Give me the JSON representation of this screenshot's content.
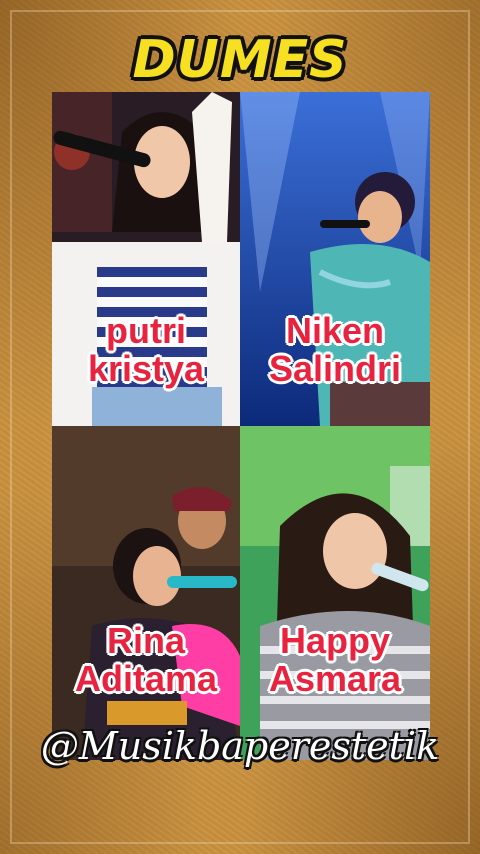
{
  "title": "DUMES",
  "panels": [
    {
      "line1": "putri",
      "line2": "kristya"
    },
    {
      "line1": "Niken",
      "line2": "Salindri"
    },
    {
      "line1": "Rina",
      "line2": "Aditama"
    },
    {
      "line1": "Happy",
      "line2": "Asmara"
    }
  ],
  "watermark": "@Musikbaperestetik",
  "colors": {
    "background": "#c9913f",
    "title_fill": "#f7e021",
    "label_fill": "#e8233f",
    "label_outline": "#ffffff"
  }
}
